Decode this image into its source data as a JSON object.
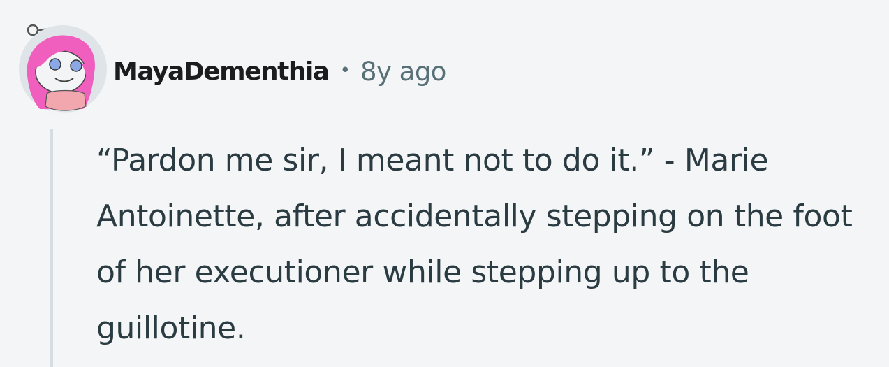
{
  "comment": {
    "author": "MayaDementhia",
    "separator": "•",
    "timestamp": "8y ago",
    "body": "“Pardon me sir, I meant not to do it.” - Marie Antoinette, after accidentally stepping on the foot of her executioner while stepping up to the guillotine."
  },
  "colors": {
    "background": "#f4f5f7",
    "author": "#1c1c1c",
    "meta": "#576f76",
    "body": "#2a3c42",
    "thread_line": "#d4dde3",
    "avatar_hair": "#f05fbe",
    "avatar_bg": "#dfe4e8"
  },
  "icons": {
    "avatar": "snoo-avatar-pink-hair"
  }
}
